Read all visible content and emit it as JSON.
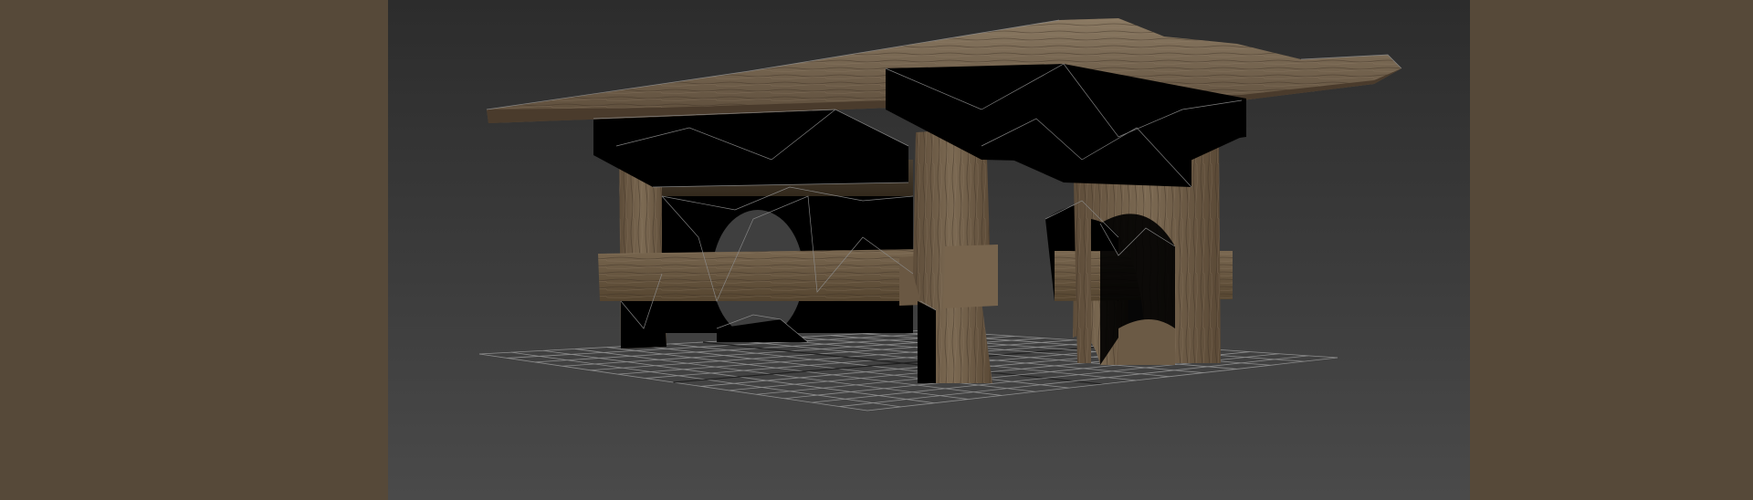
{
  "colors": {
    "side_panel": "#564939",
    "viewport_bg_top": "#2c2c2c",
    "viewport_bg_bottom": "#4a4a4a",
    "grid_line": "#9a9a9a",
    "grid_axis": "#1a1a1a",
    "wood_light": "#7a6a55",
    "wood_dark": "#4d3e2e",
    "untextured_face": "#000000",
    "wireframe_edge": "#8c8c8c"
  },
  "viewport": {
    "content": "3d-model-rustic-wooden-table",
    "shading": "textured-with-wireframe-overlay",
    "grid_visible": true
  }
}
